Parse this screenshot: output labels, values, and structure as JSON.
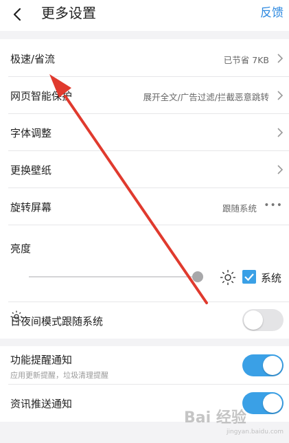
{
  "header": {
    "title": "更多设置",
    "feedback_label": "反馈"
  },
  "rows": {
    "speed": {
      "label": "极速/省流",
      "value": "已节省 7KB"
    },
    "smart": {
      "label": "网页智能保护",
      "value": "展开全文/广告过滤/拦截恶意跳转"
    },
    "font": {
      "label": "字体调整"
    },
    "wallpaper": {
      "label": "更换壁纸"
    },
    "rotate": {
      "label": "旋转屏幕",
      "value": "跟随系统",
      "more": "•••"
    },
    "brightness": {
      "label": "亮度",
      "system_label": "系统",
      "system_checked": true,
      "level_fraction": 0.98
    },
    "night": {
      "label": "日夜间模式跟随系统",
      "enabled": false
    },
    "reminder": {
      "label": "功能提醒通知",
      "sub": "应用更新提醒，垃圾清理提醒",
      "enabled": true
    },
    "news": {
      "label": "资讯推送通知",
      "enabled": true
    }
  },
  "watermark": {
    "text": "Bai 经验",
    "sub": "jingyan.baidu.com"
  },
  "colors": {
    "accent": "#3aa0e6",
    "link": "#2f8ae0",
    "annotation_arrow": "#e03a2e"
  }
}
